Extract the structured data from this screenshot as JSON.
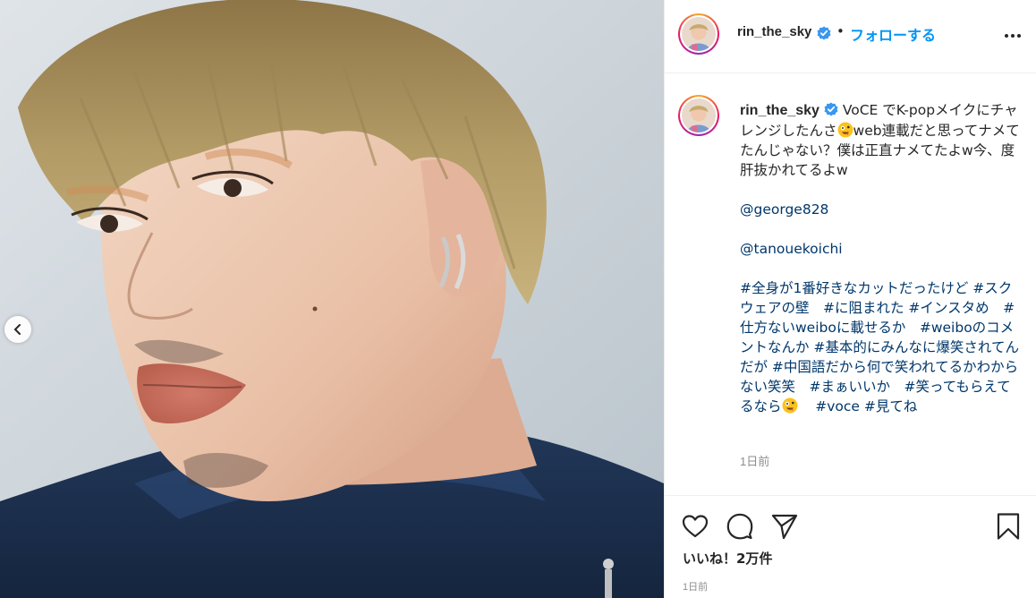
{
  "post": {
    "username": "rin_the_sky",
    "separator": "•",
    "follow_label": "フォローする",
    "caption": {
      "intro_a": "VoCE でK-popメイクにチャレンジしたんさ",
      "intro_b": "web連載だと思ってナメてたんじゃない？僕は正直ナメてたよw今、度肝抜かれてるよw",
      "mention_1": "@george828",
      "mention_2": "@tanouekoichi",
      "tags_1": "#全身が1番好きなカットだったけど #スクウェアの壁　#に阻まれた #インスタめ　#仕方ないweiboに載せるか　#weiboのコメントなんか #基本的にみんなに爆笑されてんだが #中国語だから何で笑われてるかわからない笑笑　#まぁいいか　#笑ってもらえてるなら",
      "tags_2": "#voce #見てね",
      "time": "1日前"
    },
    "likes": "いいね！2万件",
    "time": "1日前"
  },
  "icons": {
    "verified": "verified-badge-icon",
    "more": "more-options-icon",
    "like": "heart-icon",
    "comment": "comment-icon",
    "share": "paper-plane-icon",
    "save": "bookmark-icon",
    "prev": "chevron-left-icon",
    "emoji": "zany-face-emoji"
  },
  "colors": {
    "link_blue": "#0095f6",
    "tag_blue": "#00376b",
    "verified": "#3897f0",
    "muted": "#8e8e8e",
    "text": "#262626"
  }
}
